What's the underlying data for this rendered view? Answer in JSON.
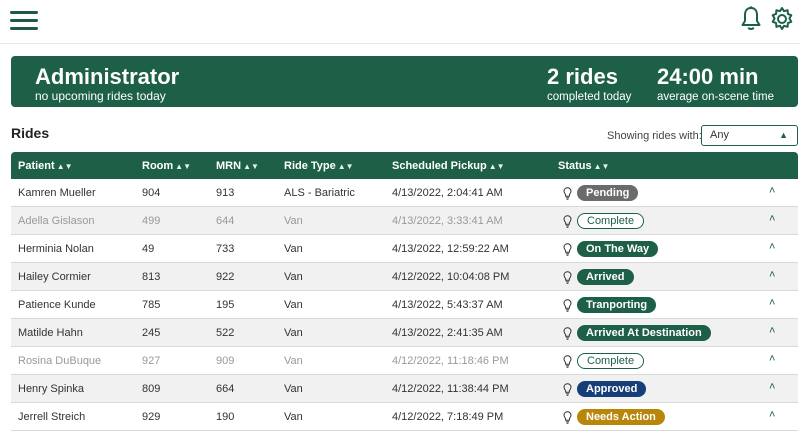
{
  "header": {
    "menu_icon": "hamburger-icon",
    "bell_icon": "bell-icon",
    "settings_icon": "gear-icon",
    "accent": "#1d6047"
  },
  "banner": {
    "title": "Administrator",
    "subtitle": "no upcoming rides today",
    "stats": [
      {
        "value": "2 rides",
        "label": "completed today"
      },
      {
        "value": "24:00 min",
        "label": "average on-scene time"
      }
    ]
  },
  "rides": {
    "heading": "Rides",
    "filter_label": "Showing rides with:",
    "filter_value": "Any",
    "columns": [
      "Patient",
      "Room",
      "MRN",
      "Ride Type",
      "Scheduled Pickup",
      "Status"
    ],
    "rows": [
      {
        "patient": "Kamren Mueller",
        "room": "904",
        "mrn": "913",
        "ride_type": "ALS - Bariatric",
        "pickup": "4/13/2022, 2:04:41 AM",
        "status": "Pending",
        "status_color": "#6b6b6b",
        "outline": false,
        "dim": false
      },
      {
        "patient": "Adella Gislason",
        "room": "499",
        "mrn": "644",
        "ride_type": "Van",
        "pickup": "4/13/2022, 3:33:41 AM",
        "status": "Complete",
        "status_color": "#1d6047",
        "outline": true,
        "dim": true
      },
      {
        "patient": "Herminia Nolan",
        "room": "49",
        "mrn": "733",
        "ride_type": "Van",
        "pickup": "4/13/2022, 12:59:22 AM",
        "status": "On The Way",
        "status_color": "#1d6047",
        "outline": false,
        "dim": false
      },
      {
        "patient": "Hailey Cormier",
        "room": "813",
        "mrn": "922",
        "ride_type": "Van",
        "pickup": "4/12/2022, 10:04:08 PM",
        "status": "Arrived",
        "status_color": "#1d6047",
        "outline": false,
        "dim": false
      },
      {
        "patient": "Patience Kunde",
        "room": "785",
        "mrn": "195",
        "ride_type": "Van",
        "pickup": "4/13/2022, 5:43:37 AM",
        "status": "Tranporting",
        "status_color": "#1d6047",
        "outline": false,
        "dim": false
      },
      {
        "patient": "Matilde Hahn",
        "room": "245",
        "mrn": "522",
        "ride_type": "Van",
        "pickup": "4/13/2022, 2:41:35 AM",
        "status": "Arrived At Destination",
        "status_color": "#1d6047",
        "outline": false,
        "dim": false
      },
      {
        "patient": "Rosina DuBuque",
        "room": "927",
        "mrn": "909",
        "ride_type": "Van",
        "pickup": "4/12/2022, 11:18:46 PM",
        "status": "Complete",
        "status_color": "#1d6047",
        "outline": true,
        "dim": true
      },
      {
        "patient": "Henry Spinka",
        "room": "809",
        "mrn": "664",
        "ride_type": "Van",
        "pickup": "4/12/2022, 11:38:44 PM",
        "status": "Approved",
        "status_color": "#163f7a",
        "outline": false,
        "dim": false
      },
      {
        "patient": "Jerrell Streich",
        "room": "929",
        "mrn": "190",
        "ride_type": "Van",
        "pickup": "4/12/2022, 7:18:49 PM",
        "status": "Needs Action",
        "status_color": "#b8860b",
        "outline": false,
        "dim": false
      }
    ]
  }
}
